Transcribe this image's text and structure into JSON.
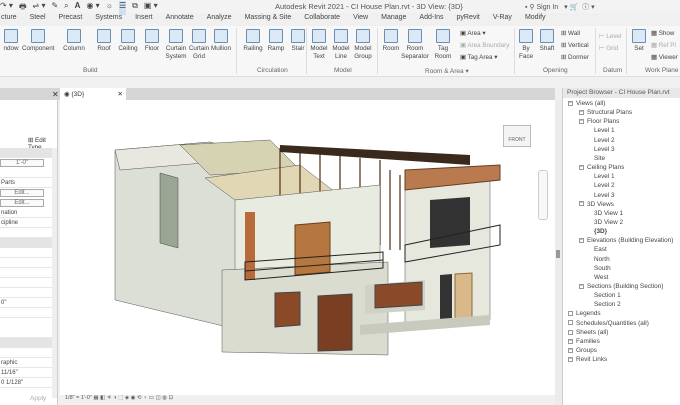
{
  "title_bar": {
    "title": "Autodesk Revit 2021 - CI House Plan.rvt - 3D View: {3D}",
    "sign_in": "Sign In"
  },
  "tabs": [
    "cture",
    "Steel",
    "Precast",
    "Systems",
    "Insert",
    "Annotate",
    "Analyze",
    "Massing & Site",
    "Collaborate",
    "View",
    "Manage",
    "Add-Ins",
    "pyRevit",
    "V-Ray",
    "Modify"
  ],
  "ribbon": {
    "build": {
      "label": "Build",
      "tools": [
        "ndow",
        "Component",
        "Column",
        "Roof",
        "Ceiling",
        "Floor",
        "Curtain System",
        "Curtain Grid",
        "Mullion"
      ]
    },
    "circulation": {
      "label": "Circulation",
      "tools": [
        "Railing",
        "Ramp",
        "Stair"
      ]
    },
    "model": {
      "label": "Model",
      "tools": [
        "Model Text",
        "Model Line",
        "Model Group"
      ]
    },
    "room_area": {
      "label": "Room & Area ▾",
      "tools": [
        "Room",
        "Room Separator",
        "Tag Room"
      ],
      "small": [
        "Area ▾",
        "Area Boundary",
        "Tag Area ▾"
      ]
    },
    "opening": {
      "label": "Opening",
      "tools": [
        "By Face",
        "Shaft"
      ],
      "small": [
        "Wall",
        "Vertical",
        "Dormer"
      ]
    },
    "datum": {
      "label": "Datum",
      "small": [
        "Level",
        "Grid"
      ]
    },
    "work_plane": {
      "label": "Work Plane",
      "tools": [
        "Set"
      ],
      "small": [
        "Show",
        "Ref Pl",
        "Viewer"
      ]
    }
  },
  "view_tab": {
    "label": "{3D}"
  },
  "properties": {
    "edit_type": "Edit Type",
    "rows": [
      "1'-0\"",
      "",
      "Parts",
      "Edit...",
      "Edit...",
      "nation",
      "cipline",
      "",
      "",
      "",
      "",
      "",
      "",
      "0\"",
      "",
      "",
      "Edit...",
      "",
      "raphic",
      "11/16\"",
      "0 1/128\""
    ],
    "apply": "Apply"
  },
  "status": {
    "scale": "1/8\" = 1'-0\""
  },
  "viewcube": {
    "face": "FRONT"
  },
  "browser": {
    "title": "Project Browser - CI House Plan.rvt",
    "tree": [
      {
        "t": "Views (all)",
        "l": 0
      },
      {
        "t": "Structural Plans",
        "l": 1
      },
      {
        "t": "Floor Plans",
        "l": 1
      },
      {
        "t": "Level 1",
        "l": 2
      },
      {
        "t": "Level 2",
        "l": 2
      },
      {
        "t": "Level 3",
        "l": 2
      },
      {
        "t": "Site",
        "l": 2
      },
      {
        "t": "Ceiling Plans",
        "l": 1
      },
      {
        "t": "Level 1",
        "l": 2
      },
      {
        "t": "Level 2",
        "l": 2
      },
      {
        "t": "Level 3",
        "l": 2
      },
      {
        "t": "3D Views",
        "l": 1
      },
      {
        "t": "3D View 1",
        "l": 2
      },
      {
        "t": "3D View 2",
        "l": 2
      },
      {
        "t": "{3D}",
        "l": 2,
        "bold": true
      },
      {
        "t": "Elevations (Building Elevation)",
        "l": 1
      },
      {
        "t": "East",
        "l": 2
      },
      {
        "t": "North",
        "l": 2
      },
      {
        "t": "South",
        "l": 2
      },
      {
        "t": "West",
        "l": 2
      },
      {
        "t": "Sections (Building Section)",
        "l": 1
      },
      {
        "t": "Section 1",
        "l": 2
      },
      {
        "t": "Section 2",
        "l": 2
      },
      {
        "t": "Legends",
        "l": 0
      },
      {
        "t": "Schedules/Quantities (all)",
        "l": 0
      },
      {
        "t": "Sheets (all)",
        "l": 0
      },
      {
        "t": "Families",
        "l": 0
      },
      {
        "t": "Groups",
        "l": 0
      },
      {
        "t": "Revit Links",
        "l": 0
      }
    ]
  }
}
